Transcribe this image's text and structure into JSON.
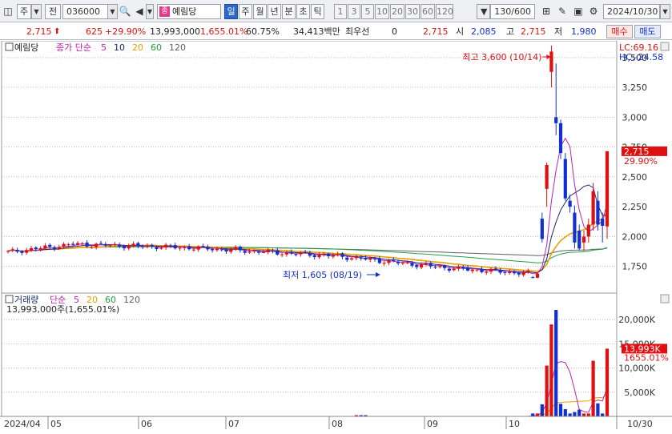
{
  "toolbar": {
    "market_type": "주",
    "prev_label": "전",
    "code": "036000",
    "stock_name": "예림당",
    "stock_badge": "종",
    "periods": [
      "일",
      "주",
      "월",
      "년",
      "분",
      "초",
      "틱"
    ],
    "selected_period": "일",
    "intervals": [
      "1",
      "3",
      "5",
      "10",
      "20",
      "30",
      "60",
      "120"
    ],
    "count": "130/600",
    "date": "2024/10/30"
  },
  "quote": {
    "price": "2,715",
    "change": "625",
    "change_pct": "+29.90%",
    "volume": "13,993,000",
    "volume_ratio": "1,655.01%",
    "turnover": "60.75%",
    "amount": "34,413백만",
    "priority_label": "최우선",
    "priority_value": "0",
    "last": "2,715",
    "open_label": "시",
    "open": "2,085",
    "high_label": "고",
    "high": "2,715",
    "low_label": "저",
    "low": "1,980",
    "buy_label": "매수",
    "sell_label": "매도"
  },
  "price_panel": {
    "title": "예림당",
    "ma_label": "종가 단순",
    "ma_periods": [
      "5",
      "10",
      "20",
      "60",
      "120"
    ],
    "lc_label": "LC:69.16",
    "hc_label": "HC:-24.58",
    "high_annotation": "최고 3,600 (10/14)",
    "low_annotation": "최저 1,605 (08/19)",
    "last_price_tag": "2,715",
    "last_pct_tag": "29.90%"
  },
  "volume_panel": {
    "title": "거래량",
    "ma_label": "단순",
    "ma_periods": [
      "5",
      "20",
      "60",
      "120"
    ],
    "subtitle": "13,993,000주(1,655.01%)",
    "last_volume_tag": "13,993K",
    "last_pct_tag": "1655.01%"
  },
  "x_axis": {
    "start_label": "2024/04",
    "month_labels": [
      "05",
      "06",
      "07",
      "08",
      "09",
      "10"
    ],
    "end_label": "10/30"
  },
  "colors": {
    "up": "#e01010",
    "down": "#1230d0",
    "ma5": "#c020b0",
    "ma10": "#1a2a70",
    "ma20": "#e8a000",
    "ma60": "#20a040",
    "ma120": "#606060"
  },
  "chart_data": [
    {
      "type": "candlestick",
      "title": "예림당",
      "y_ticks": [
        1750,
        2000,
        2250,
        2500,
        2750,
        3000,
        3250,
        3500
      ],
      "ylim": [
        1560,
        3620
      ],
      "grid": true,
      "legend": "top-left",
      "series_names": [
        "종가 단순 5",
        "10",
        "20",
        "60",
        "120"
      ],
      "candles_recent": [
        {
          "date": "10/07",
          "open": 1660,
          "high": 1670,
          "low": 1650,
          "close": 1655
        },
        {
          "date": "10/08",
          "open": 1655,
          "high": 1700,
          "low": 1650,
          "close": 1690
        },
        {
          "date": "10/10",
          "open": 2150,
          "high": 2200,
          "low": 1950,
          "close": 1980
        },
        {
          "date": "10/11",
          "open": 2400,
          "high": 2620,
          "low": 2250,
          "close": 2600
        },
        {
          "date": "10/14",
          "open": 3380,
          "high": 3600,
          "low": 3250,
          "close": 3550
        },
        {
          "date": "10/15",
          "open": 3000,
          "high": 3450,
          "low": 2850,
          "close": 2950
        },
        {
          "date": "10/16",
          "open": 2950,
          "high": 2980,
          "low": 2650,
          "close": 2700
        },
        {
          "date": "10/17",
          "open": 2650,
          "high": 2700,
          "low": 2300,
          "close": 2320
        },
        {
          "date": "10/18",
          "open": 2300,
          "high": 2350,
          "low": 2200,
          "close": 2250
        },
        {
          "date": "10/21",
          "open": 2200,
          "high": 2260,
          "low": 1900,
          "close": 1950
        },
        {
          "date": "10/22",
          "open": 2050,
          "high": 2100,
          "low": 1880,
          "close": 1900
        },
        {
          "date": "10/23",
          "open": 1950,
          "high": 2050,
          "low": 1880,
          "close": 2000
        },
        {
          "date": "10/24",
          "open": 2000,
          "high": 2150,
          "low": 1950,
          "close": 2100
        },
        {
          "date": "10/25",
          "open": 2100,
          "high": 2450,
          "low": 2050,
          "close": 2380
        },
        {
          "date": "10/28",
          "open": 2300,
          "high": 2380,
          "low": 2050,
          "close": 2100
        },
        {
          "date": "10/29",
          "open": 2150,
          "high": 2200,
          "low": 1950,
          "close": 2090
        },
        {
          "date": "10/30",
          "open": 2085,
          "high": 2715,
          "low": 1980,
          "close": 2715
        }
      ]
    },
    {
      "type": "bar",
      "title": "거래량",
      "y_ticks": [
        "5,000K",
        "10,000K",
        "15,000K",
        "20,000K"
      ],
      "ylim_thousands": [
        0,
        23000
      ],
      "recent_volumes_thousands": [
        {
          "date": "10/10",
          "value": 2500
        },
        {
          "date": "10/11",
          "value": 10500
        },
        {
          "date": "10/14",
          "value": 19000
        },
        {
          "date": "10/15",
          "value": 22000
        },
        {
          "date": "10/16",
          "value": 2600
        },
        {
          "date": "10/17",
          "value": 1500
        },
        {
          "date": "10/21",
          "value": 900
        },
        {
          "date": "10/22",
          "value": 1400
        },
        {
          "date": "10/25",
          "value": 11500
        },
        {
          "date": "10/28",
          "value": 2700
        },
        {
          "date": "10/30",
          "value": 13993
        }
      ]
    }
  ]
}
